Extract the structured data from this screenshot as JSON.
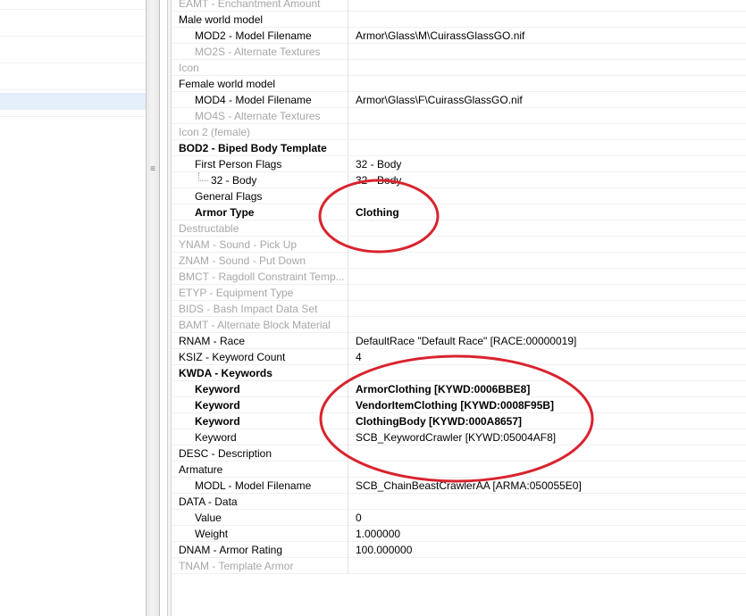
{
  "records": [
    {
      "name": "EAMT - Enchantment Amount",
      "value": "",
      "level": 0,
      "style": "disabled"
    },
    {
      "name": "Male world model",
      "value": "",
      "level": 0,
      "style": "normal"
    },
    {
      "name": "MOD2 - Model Filename",
      "value": "Armor\\Glass\\M\\CuirassGlassGO.nif",
      "level": 1,
      "style": "normal"
    },
    {
      "name": "MO2S - Alternate Textures",
      "value": "",
      "level": 1,
      "style": "disabled"
    },
    {
      "name": "Icon",
      "value": "",
      "level": 0,
      "style": "disabled"
    },
    {
      "name": "Female world model",
      "value": "",
      "level": 0,
      "style": "normal"
    },
    {
      "name": "MOD4 - Model Filename",
      "value": "Armor\\Glass\\F\\CuirassGlassGO.nif",
      "level": 1,
      "style": "normal"
    },
    {
      "name": "MO4S - Alternate Textures",
      "value": "",
      "level": 1,
      "style": "disabled"
    },
    {
      "name": "Icon 2 (female)",
      "value": "",
      "level": 0,
      "style": "disabled"
    },
    {
      "name": "BOD2 - Biped Body Template",
      "value": "",
      "level": 0,
      "style": "bold"
    },
    {
      "name": "First Person Flags",
      "value": "32 - Body",
      "level": 1,
      "style": "normal"
    },
    {
      "name": "32 - Body",
      "value": "32 - Body",
      "level": 2,
      "style": "normal"
    },
    {
      "name": "General Flags",
      "value": "",
      "level": 1,
      "style": "normal"
    },
    {
      "name": "Armor Type",
      "value": "Clothing",
      "level": 1,
      "style": "bold"
    },
    {
      "name": "Destructable",
      "value": "",
      "level": 0,
      "style": "disabled"
    },
    {
      "name": "YNAM - Sound - Pick Up",
      "value": "",
      "level": 0,
      "style": "disabled"
    },
    {
      "name": "ZNAM - Sound - Put Down",
      "value": "",
      "level": 0,
      "style": "disabled"
    },
    {
      "name": "BMCT - Ragdoll Constraint Temp...",
      "value": "",
      "level": 0,
      "style": "disabled"
    },
    {
      "name": "ETYP - Equipment Type",
      "value": "",
      "level": 0,
      "style": "disabled"
    },
    {
      "name": "BIDS - Bash Impact Data Set",
      "value": "",
      "level": 0,
      "style": "disabled"
    },
    {
      "name": "BAMT - Alternate Block Material",
      "value": "",
      "level": 0,
      "style": "disabled"
    },
    {
      "name": "RNAM - Race",
      "value": "DefaultRace \"Default Race\" [RACE:00000019]",
      "level": 0,
      "style": "normal"
    },
    {
      "name": "KSIZ - Keyword Count",
      "value": "4",
      "level": 0,
      "style": "normal"
    },
    {
      "name": "KWDA - Keywords",
      "value": "",
      "level": 0,
      "style": "bold"
    },
    {
      "name": "Keyword",
      "value": "ArmorClothing [KYWD:0006BBE8]",
      "level": 1,
      "style": "bold"
    },
    {
      "name": "Keyword",
      "value": "VendorItemClothing [KYWD:0008F95B]",
      "level": 1,
      "style": "bold"
    },
    {
      "name": "Keyword",
      "value": "ClothingBody [KYWD:000A8657]",
      "level": 1,
      "style": "bold"
    },
    {
      "name": "Keyword",
      "value": "SCB_KeywordCrawler [KYWD:05004AF8]",
      "level": 1,
      "style": "normal"
    },
    {
      "name": "DESC - Description",
      "value": "",
      "level": 0,
      "style": "normal"
    },
    {
      "name": "Armature",
      "value": "",
      "level": 0,
      "style": "normal"
    },
    {
      "name": "MODL - Model Filename",
      "value": "SCB_ChainBeastCrawlerAA [ARMA:050055E0]",
      "level": 1,
      "style": "normal"
    },
    {
      "name": "DATA - Data",
      "value": "",
      "level": 0,
      "style": "normal"
    },
    {
      "name": "Value",
      "value": "0",
      "level": 1,
      "style": "normal"
    },
    {
      "name": "Weight",
      "value": "1.000000",
      "level": 1,
      "style": "normal"
    },
    {
      "name": "DNAM - Armor Rating",
      "value": "100.000000",
      "level": 0,
      "style": "normal"
    },
    {
      "name": "TNAM - Template Armor",
      "value": "",
      "level": 0,
      "style": "disabled"
    }
  ],
  "splitter_grip": "≡",
  "annotation_color": "#d9232e"
}
